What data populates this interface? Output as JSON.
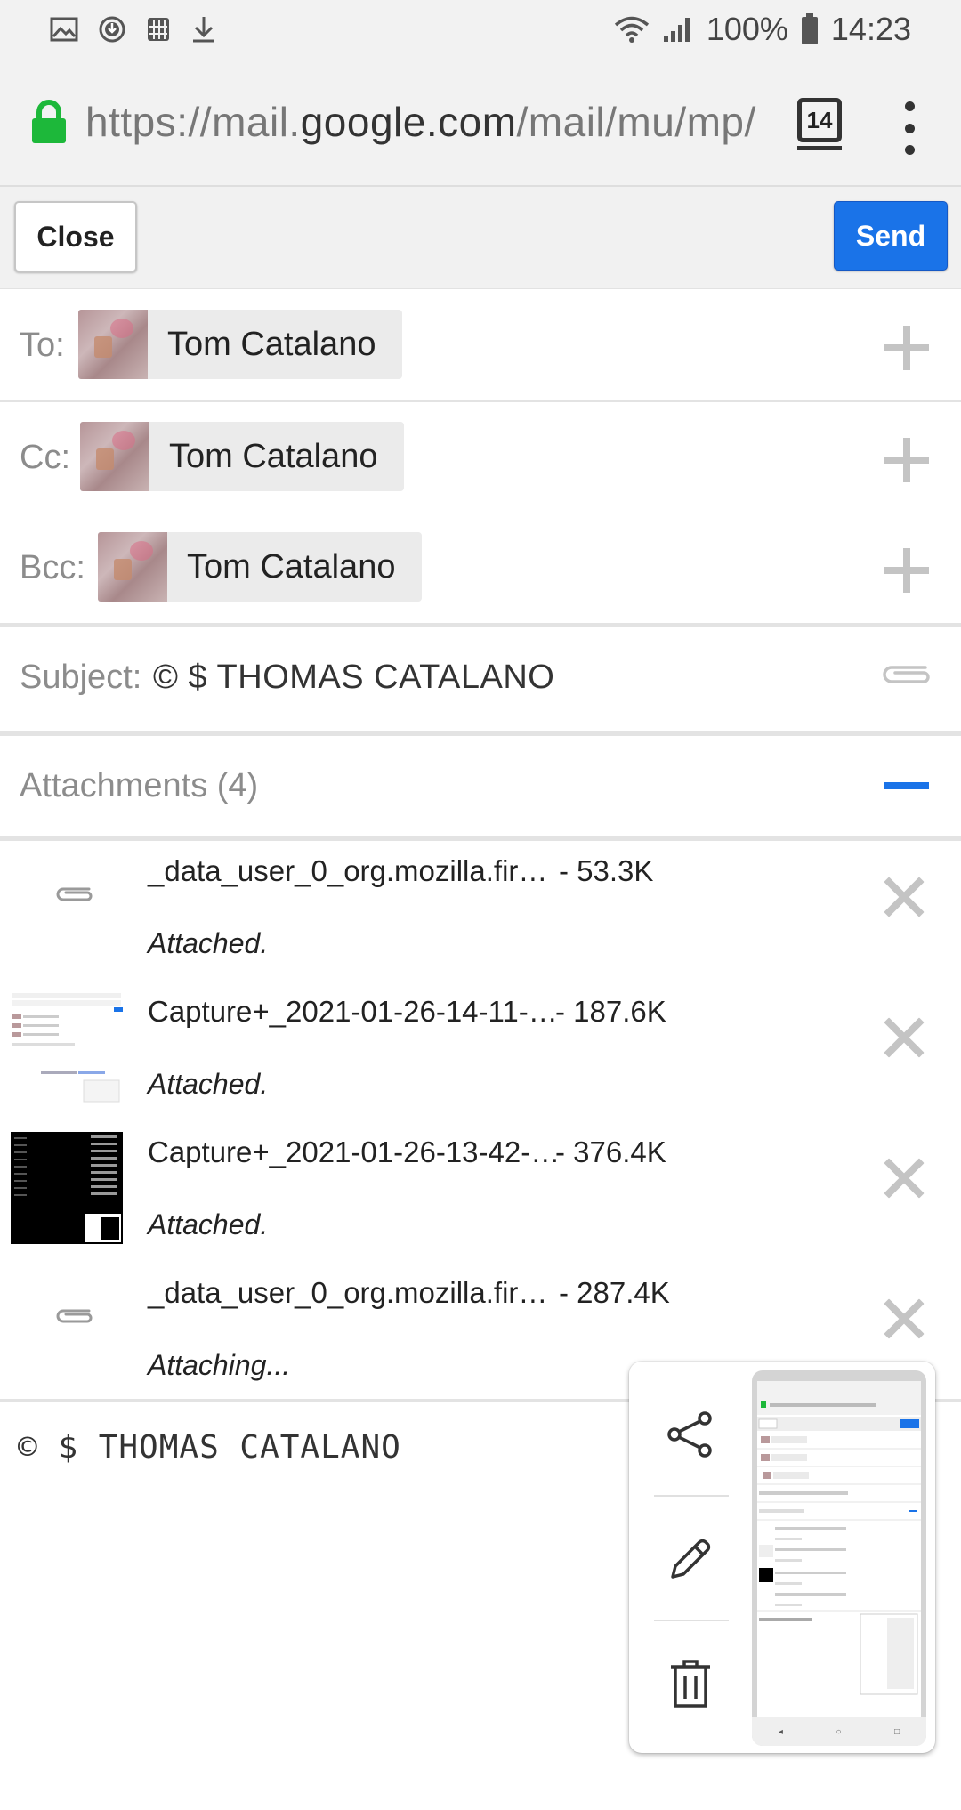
{
  "status_bar": {
    "battery_percent": "100%",
    "time": "14:23",
    "left_icons": [
      "image-icon",
      "download-circle-icon",
      "grid-icon",
      "download-icon"
    ],
    "right_icons": [
      "wifi-icon",
      "signal-icon",
      "battery-icon"
    ]
  },
  "browser": {
    "url_prefix": "https://mail.",
    "url_host": "google.com",
    "url_path": "/mail/mu/mp/",
    "tab_count": "14"
  },
  "compose": {
    "close_label": "Close",
    "send_label": "Send",
    "to": {
      "label": "To:",
      "name": "Tom Catalano"
    },
    "cc": {
      "label": "Cc:",
      "name": "Tom Catalano"
    },
    "bcc": {
      "label": "Bcc:",
      "name": "Tom Catalano"
    },
    "subject_label": "Subject:",
    "subject_value": "© $ THOMAS CATALANO",
    "attachments_title": "Attachments (4)",
    "attachments": [
      {
        "name": "_data_user_0_org.mozilla.fir…",
        "size": "- 53.3K",
        "status": "Attached."
      },
      {
        "name": "Capture+_2021-01-26-14-11-…",
        "size": "- 187.6K",
        "status": "Attached."
      },
      {
        "name": "Capture+_2021-01-26-13-42-…",
        "size": "- 376.4K",
        "status": "Attached."
      },
      {
        "name": "_data_user_0_org.mozilla.fir…",
        "size": "- 287.4K",
        "status": "Attaching..."
      }
    ],
    "body": "© $ THOMAS CATALANO"
  },
  "screenshot_popup": {
    "actions": [
      "share-icon",
      "edit-pencil-icon",
      "delete-trash-icon"
    ]
  },
  "colors": {
    "accent": "#1a73e8",
    "lock_green": "#1db83a"
  }
}
